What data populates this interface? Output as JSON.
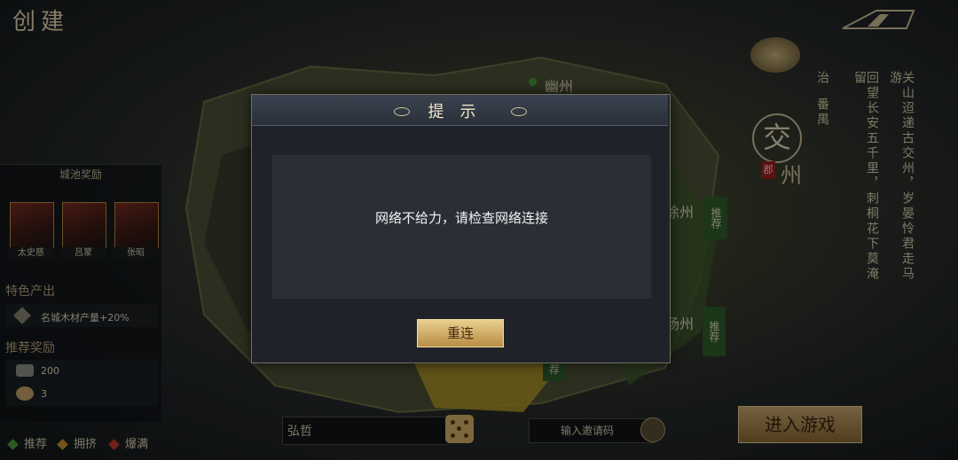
{
  "header": {
    "title": "创建"
  },
  "map": {
    "labels": [
      "幽州",
      "徐州",
      "扬州",
      "荐",
      "推荐",
      "推荐"
    ]
  },
  "left_panel": {
    "reward_title": "城池奖励",
    "heroes": [
      {
        "name": "太史慈"
      },
      {
        "name": "吕蒙"
      },
      {
        "name": "张昭"
      }
    ],
    "special_title": "特色产出",
    "special_item": "名城木材产量+20%",
    "recommend_title": "推荐奖励",
    "rewards": [
      {
        "icon": "ingot-icon",
        "value": "200"
      },
      {
        "icon": "coin-bowl-icon",
        "value": "3"
      }
    ]
  },
  "right_panel": {
    "region_char": "交",
    "region_seal": "郡",
    "region_zhou": "州",
    "poem_line1": "关山迢递古交州，岁晏怜君走马游",
    "poem_line2": "回望长安五千里，刺桐花下莫淹留",
    "note_col1": "治",
    "note_col2": "番禺"
  },
  "bottom": {
    "legend": [
      {
        "label": "推荐",
        "color": "#4c9a3c"
      },
      {
        "label": "拥挤",
        "color": "#c9902e"
      },
      {
        "label": "爆满",
        "color": "#c23a2a"
      }
    ],
    "name_value": "弘哲",
    "invite_placeholder": "输入邀请码",
    "enter_label": "进入游戏"
  },
  "dialog": {
    "title": "提示",
    "message": "网络不给力，请检查网络连接",
    "button": "重连"
  }
}
